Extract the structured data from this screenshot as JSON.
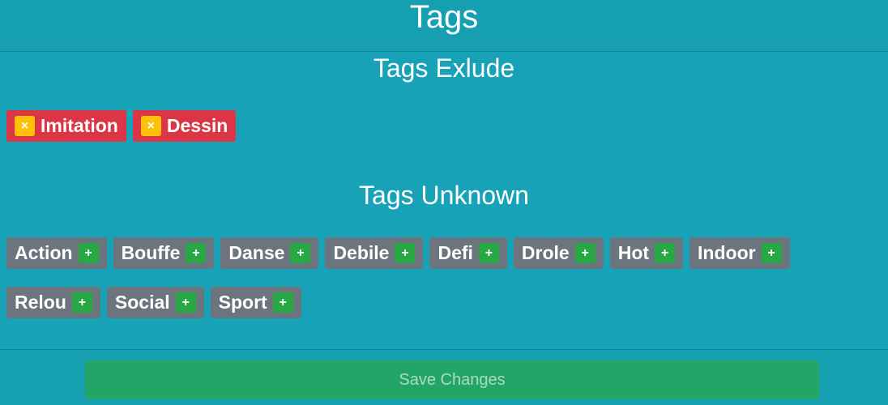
{
  "header": {
    "title": "Tags"
  },
  "sections": {
    "exclude_title": "Tags Exlude",
    "unknown_title": "Tags Unknown"
  },
  "excluded_tags": [
    {
      "label": "Imitation",
      "remove_icon": "×"
    },
    {
      "label": "Dessin",
      "remove_icon": "×"
    }
  ],
  "unknown_tags": [
    {
      "label": "Action",
      "add_icon": "+"
    },
    {
      "label": "Bouffe",
      "add_icon": "+"
    },
    {
      "label": "Danse",
      "add_icon": "+"
    },
    {
      "label": "Debile",
      "add_icon": "+"
    },
    {
      "label": "Defi",
      "add_icon": "+"
    },
    {
      "label": "Drole",
      "add_icon": "+"
    },
    {
      "label": "Hot",
      "add_icon": "+"
    },
    {
      "label": "Indoor",
      "add_icon": "+"
    },
    {
      "label": "Relou",
      "add_icon": "+"
    },
    {
      "label": "Social",
      "add_icon": "+"
    },
    {
      "label": "Sport",
      "add_icon": "+"
    }
  ],
  "footer": {
    "save_label": "Save Changes"
  },
  "colors": {
    "background": "#17a2b8",
    "excluded_tag": "#dc3545",
    "unknown_tag": "#6c757d",
    "remove_button": "#ffc107",
    "add_button": "#28a745",
    "save_button": "#23a567"
  }
}
